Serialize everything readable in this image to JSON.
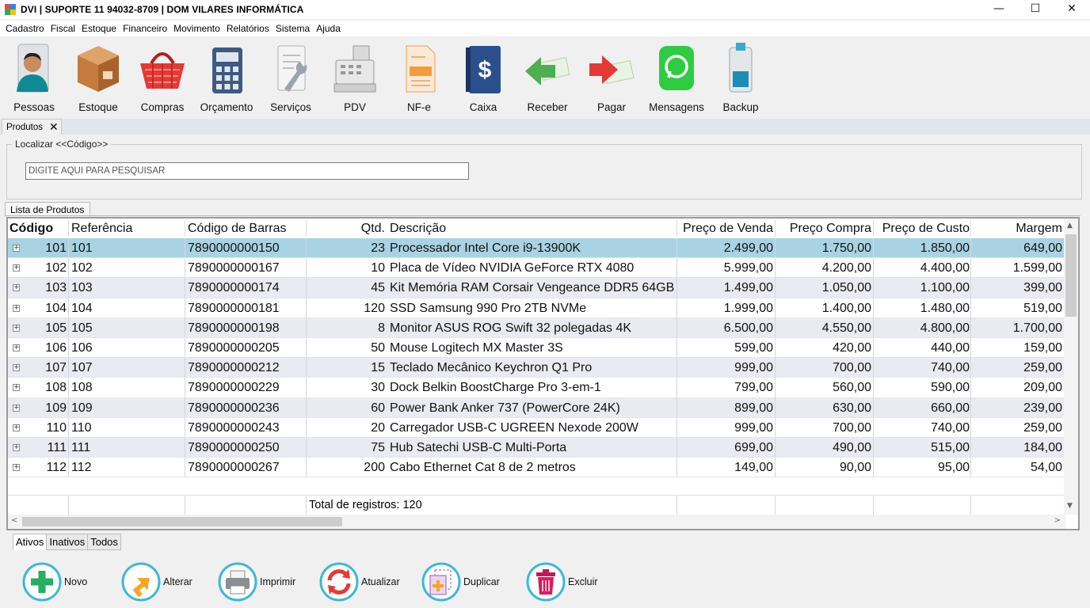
{
  "window": {
    "title": "DVI | SUPORTE 11 94032-8709 | DOM VILARES INFORMÁTICA",
    "controls": {
      "minimize": "—",
      "maximize": "☐",
      "close": "✕"
    }
  },
  "menu": [
    "Cadastro",
    "Fiscal",
    "Estoque",
    "Financeiro",
    "Movimento",
    "Relatórios",
    "Sistema",
    "Ajuda"
  ],
  "toolbar": [
    {
      "label": "Pessoas",
      "icon": "person-icon"
    },
    {
      "label": "Estoque",
      "icon": "box-icon"
    },
    {
      "label": "Compras",
      "icon": "basket-icon"
    },
    {
      "label": "Orçamento",
      "icon": "calculator-icon"
    },
    {
      "label": "Serviços",
      "icon": "wrench-icon"
    },
    {
      "label": "PDV",
      "icon": "cash-register-icon"
    },
    {
      "label": "NF-e",
      "icon": "document-icon"
    },
    {
      "label": "Caixa",
      "icon": "dollar-book-icon"
    },
    {
      "label": "Receber",
      "icon": "arrow-in-icon"
    },
    {
      "label": "Pagar",
      "icon": "arrow-out-icon"
    },
    {
      "label": "Mensagens",
      "icon": "whatsapp-icon"
    },
    {
      "label": "Backup",
      "icon": "usb-drive-icon"
    }
  ],
  "doc_tab": {
    "label": "Produtos",
    "close": "✕"
  },
  "search": {
    "legend": "Localizar <<Código>>",
    "placeholder": "DIGITE AQUI PARA PESQUISAR",
    "value": ""
  },
  "grid": {
    "tab_label": "Lista de Produtos",
    "columns": [
      "Código",
      "Referência",
      "Código de Barras",
      "Qtd.",
      "Descrição",
      "Preço de Venda",
      "Preço Compra",
      "Preço de Custo",
      "Margem"
    ],
    "rows": [
      [
        "101",
        "101",
        "7890000000150",
        "23",
        "Processador Intel Core i9-13900K",
        "2.499,00",
        "1.750,00",
        "1.850,00",
        "649,00"
      ],
      [
        "102",
        "102",
        "7890000000167",
        "10",
        "Placa de Vídeo NVIDIA GeForce RTX 4080",
        "5.999,00",
        "4.200,00",
        "4.400,00",
        "1.599,00"
      ],
      [
        "103",
        "103",
        "7890000000174",
        "45",
        "Kit Memória RAM Corsair Vengeance DDR5 64GB",
        "1.499,00",
        "1.050,00",
        "1.100,00",
        "399,00"
      ],
      [
        "104",
        "104",
        "7890000000181",
        "120",
        "SSD Samsung 990 Pro 2TB NVMe",
        "1.999,00",
        "1.400,00",
        "1.480,00",
        "519,00"
      ],
      [
        "105",
        "105",
        "7890000000198",
        "8",
        "Monitor ASUS ROG Swift 32 polegadas 4K",
        "6.500,00",
        "4.550,00",
        "4.800,00",
        "1.700,00"
      ],
      [
        "106",
        "106",
        "7890000000205",
        "50",
        "Mouse Logitech MX Master 3S",
        "599,00",
        "420,00",
        "440,00",
        "159,00"
      ],
      [
        "107",
        "107",
        "7890000000212",
        "15",
        "Teclado Mecânico Keychron Q1 Pro",
        "999,00",
        "700,00",
        "740,00",
        "259,00"
      ],
      [
        "108",
        "108",
        "7890000000229",
        "30",
        "Dock Belkin BoostCharge Pro 3-em-1",
        "799,00",
        "560,00",
        "590,00",
        "209,00"
      ],
      [
        "109",
        "109",
        "7890000000236",
        "60",
        "Power Bank Anker 737 (PowerCore 24K)",
        "899,00",
        "630,00",
        "660,00",
        "239,00"
      ],
      [
        "110",
        "110",
        "7890000000243",
        "20",
        "Carregador USB-C UGREEN Nexode 200W",
        "999,00",
        "700,00",
        "740,00",
        "259,00"
      ],
      [
        "111",
        "111",
        "7890000000250",
        "75",
        "Hub Satechi USB-C Multi-Porta",
        "699,00",
        "490,00",
        "515,00",
        "184,00"
      ],
      [
        "112",
        "112",
        "7890000000267",
        "200",
        "Cabo Ethernet Cat 8 de 2 metros",
        "149,00",
        "90,00",
        "95,00",
        "54,00"
      ]
    ],
    "total_label": "Total de registros: 120",
    "expander_glyph": "+",
    "scroll": {
      "up": "▲",
      "down": "▼",
      "left": "<",
      "right": ">"
    }
  },
  "filters": [
    "Ativos",
    "Inativos",
    "Todos"
  ],
  "actions": [
    {
      "label": "Novo",
      "icon": "plus-icon"
    },
    {
      "label": "Alterar",
      "icon": "edit-arrow-icon"
    },
    {
      "label": "Imprimir",
      "icon": "printer-icon"
    },
    {
      "label": "Atualizar",
      "icon": "refresh-icon"
    },
    {
      "label": "Duplicar",
      "icon": "duplicate-icon"
    },
    {
      "label": "Excluir",
      "icon": "trash-icon"
    }
  ],
  "colors": {
    "selected_row": "#a9d3e3",
    "alt_row": "#eaeaf2",
    "action_ring": "#3fb8d6"
  }
}
